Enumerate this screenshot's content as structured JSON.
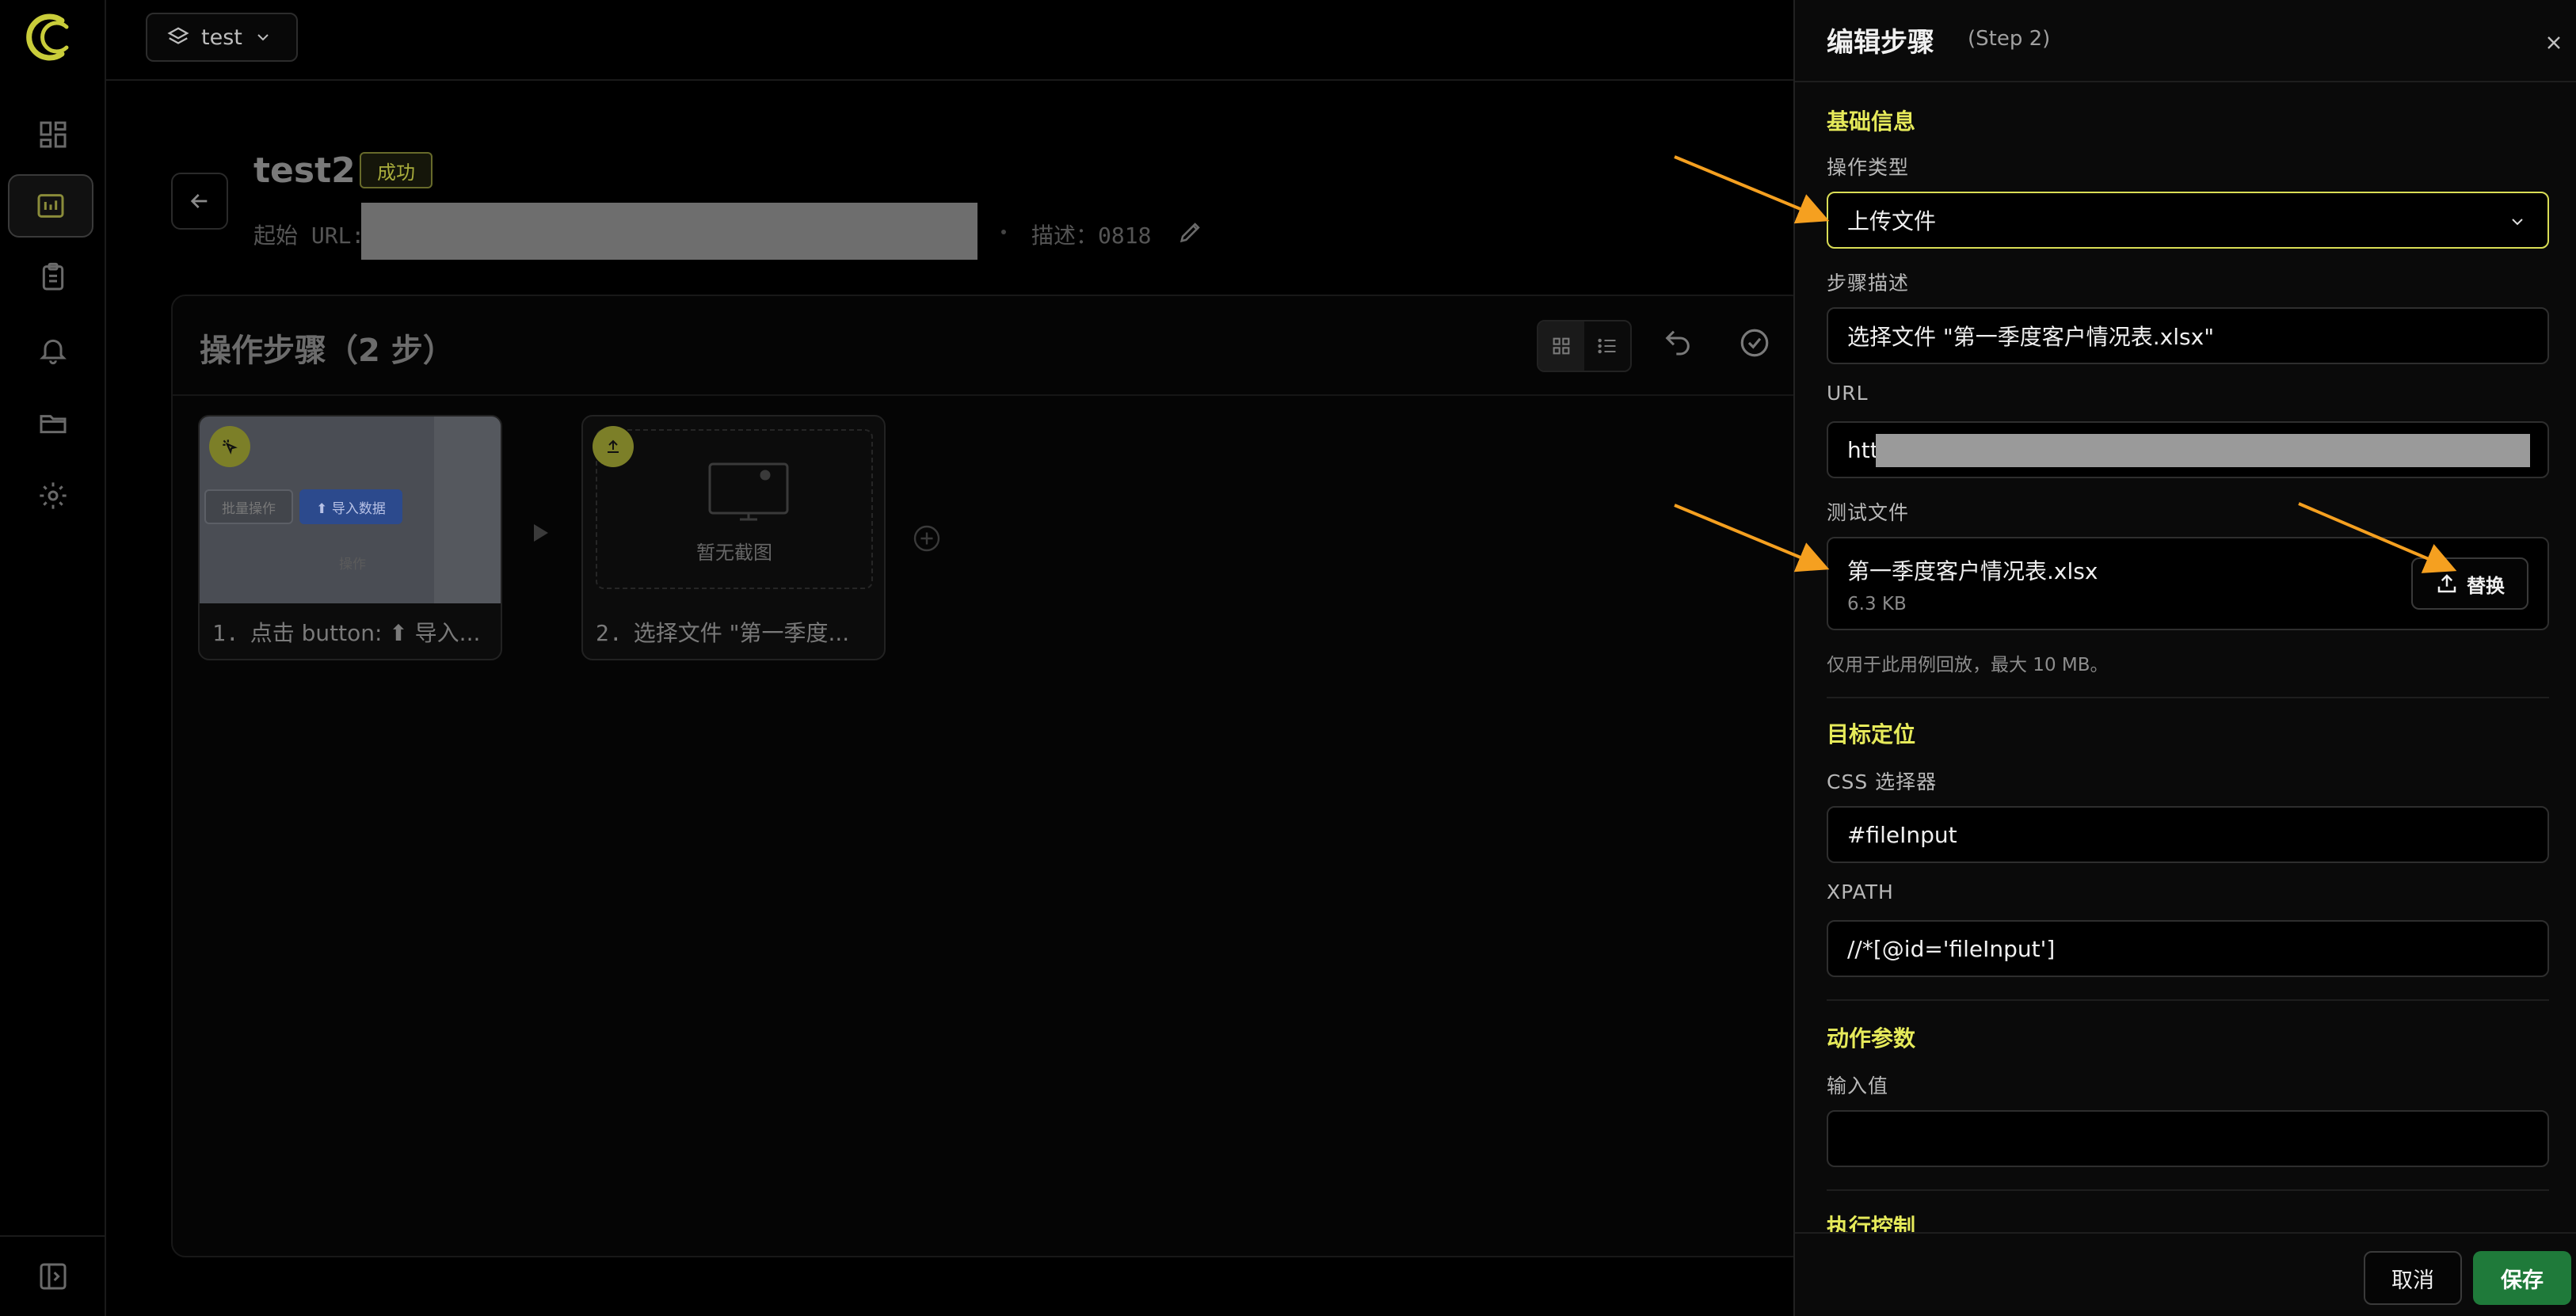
{
  "app": {
    "project_name": "test"
  },
  "case": {
    "title": "test2",
    "status": "成功",
    "url_label": "起始 URL:",
    "description": "描述：0818"
  },
  "steps_panel": {
    "title": "操作步骤（2 步）",
    "steps": [
      {
        "index": "1.",
        "label": "点击 button: ⬆ 导入...",
        "icon": "cursor-click-icon",
        "thumb": {
          "btn_a": "批量操作",
          "btn_b": "⬆ 导入数据",
          "col": "操作"
        }
      },
      {
        "index": "2.",
        "label": "选择文件 \"第一季度...",
        "icon": "upload-icon",
        "empty_text": "暂无截图"
      }
    ]
  },
  "drawer": {
    "title": "编辑步骤",
    "step_tag": "(Step 2)",
    "basic_section": "基础信息",
    "action_type_label": "操作类型",
    "action_type_value": "上传文件",
    "step_desc_label": "步骤描述",
    "step_desc_value": "选择文件 \"第一季度客户情况表.xlsx\"",
    "url_label": "URL",
    "url_value_visible": "htt",
    "test_file_label": "测试文件",
    "file_name": "第一季度客户情况表.xlsx",
    "file_size": "6.3 KB",
    "replace_label": "替换",
    "hint": "仅用于此用例回放，最大 10 MB。",
    "target_section": "目标定位",
    "css_label": "CSS 选择器",
    "css_value": "#fileInput",
    "xpath_label": "XPATH",
    "xpath_value": "//*[@id='fileInput']",
    "params_section": "动作参数",
    "input_label": "输入值",
    "input_value": "",
    "exec_section": "执行控制",
    "cancel": "取消",
    "save": "保存"
  },
  "colors": {
    "accent": "#e6ea5a",
    "save": "#1f7a3a",
    "annotation_arrow": "#f5a020"
  }
}
